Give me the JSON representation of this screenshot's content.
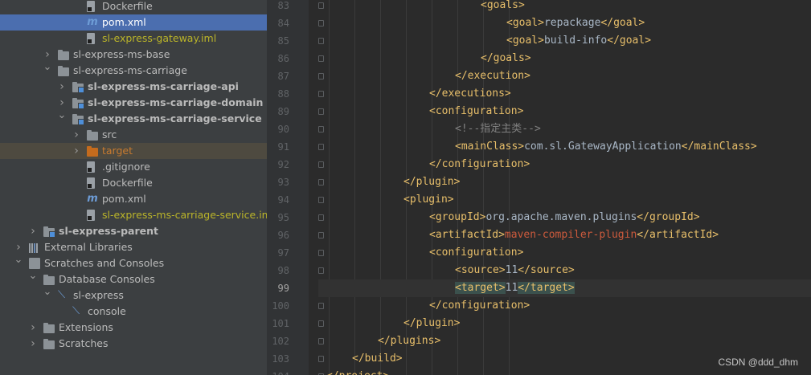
{
  "tree": {
    "rows": [
      {
        "label": "Dockerfile",
        "indent": 4,
        "arrow": "",
        "icon": "file",
        "style": "normal"
      },
      {
        "label": "pom.xml",
        "indent": 4,
        "arrow": "",
        "icon": "maven",
        "style": "selected"
      },
      {
        "label": "sl-express-gateway.iml",
        "indent": 4,
        "arrow": "",
        "icon": "file",
        "style": "yellow"
      },
      {
        "label": "sl-express-ms-base",
        "indent": 2,
        "arrow": "right",
        "icon": "folder",
        "style": "normal"
      },
      {
        "label": "sl-express-ms-carriage",
        "indent": 2,
        "arrow": "down",
        "icon": "folder",
        "style": "normal"
      },
      {
        "label": "sl-express-ms-carriage-api",
        "indent": 3,
        "arrow": "right",
        "icon": "module",
        "style": "bold"
      },
      {
        "label": "sl-express-ms-carriage-domain",
        "indent": 3,
        "arrow": "right",
        "icon": "module",
        "style": "bold"
      },
      {
        "label": "sl-express-ms-carriage-service",
        "indent": 3,
        "arrow": "down",
        "icon": "module",
        "style": "bold"
      },
      {
        "label": "src",
        "indent": 4,
        "arrow": "right",
        "icon": "folder",
        "style": "normal"
      },
      {
        "label": "target",
        "indent": 4,
        "arrow": "right",
        "icon": "folder-orange",
        "style": "excluded"
      },
      {
        "label": ".gitignore",
        "indent": 4,
        "arrow": "",
        "icon": "file",
        "style": "normal"
      },
      {
        "label": "Dockerfile",
        "indent": 4,
        "arrow": "",
        "icon": "file",
        "style": "normal"
      },
      {
        "label": "pom.xml",
        "indent": 4,
        "arrow": "",
        "icon": "maven",
        "style": "normal"
      },
      {
        "label": "sl-express-ms-carriage-service.iml",
        "indent": 4,
        "arrow": "",
        "icon": "file",
        "style": "yellow"
      },
      {
        "label": "sl-express-parent",
        "indent": 1,
        "arrow": "right",
        "icon": "module",
        "style": "bold"
      },
      {
        "label": "External Libraries",
        "indent": 0,
        "arrow": "right",
        "icon": "library",
        "style": "normal"
      },
      {
        "label": "Scratches and Consoles",
        "indent": 0,
        "arrow": "down",
        "icon": "scratch",
        "style": "normal"
      },
      {
        "label": "Database Consoles",
        "indent": 1,
        "arrow": "down",
        "icon": "folder",
        "style": "normal"
      },
      {
        "label": "sl-express",
        "indent": 2,
        "arrow": "down",
        "icon": "db",
        "style": "normal"
      },
      {
        "label": "console",
        "indent": 3,
        "arrow": "",
        "icon": "db",
        "style": "normal"
      },
      {
        "label": "Extensions",
        "indent": 1,
        "arrow": "right",
        "icon": "folder",
        "style": "normal"
      },
      {
        "label": "Scratches",
        "indent": 1,
        "arrow": "right",
        "icon": "folder",
        "style": "normal"
      }
    ]
  },
  "editor": {
    "current_line": 99,
    "lines": [
      {
        "num": "83",
        "level": 7,
        "tokens": [
          {
            "k": "t",
            "s": "<goals>"
          }
        ]
      },
      {
        "num": "84",
        "level": 8,
        "tokens": [
          {
            "k": "t",
            "s": "<goal>"
          },
          {
            "k": "v",
            "s": "repackage"
          },
          {
            "k": "t",
            "s": "</goal>"
          }
        ]
      },
      {
        "num": "85",
        "level": 8,
        "tokens": [
          {
            "k": "t",
            "s": "<goal>"
          },
          {
            "k": "v",
            "s": "build-info"
          },
          {
            "k": "t",
            "s": "</goal>"
          }
        ]
      },
      {
        "num": "86",
        "level": 7,
        "tokens": [
          {
            "k": "t",
            "s": "</goals>"
          }
        ]
      },
      {
        "num": "87",
        "level": 6,
        "tokens": [
          {
            "k": "t",
            "s": "</execution>"
          }
        ]
      },
      {
        "num": "88",
        "level": 5,
        "tokens": [
          {
            "k": "t",
            "s": "</executions>"
          }
        ]
      },
      {
        "num": "89",
        "level": 5,
        "tokens": [
          {
            "k": "t",
            "s": "<configuration>"
          }
        ]
      },
      {
        "num": "90",
        "level": 6,
        "tokens": [
          {
            "k": "c",
            "s": "<!--指定主类-->"
          }
        ]
      },
      {
        "num": "91",
        "level": 6,
        "tokens": [
          {
            "k": "t",
            "s": "<mainClass>"
          },
          {
            "k": "v",
            "s": "com.sl.GatewayApplication"
          },
          {
            "k": "t",
            "s": "</mainClass>"
          }
        ]
      },
      {
        "num": "92",
        "level": 5,
        "tokens": [
          {
            "k": "t",
            "s": "</configuration>"
          }
        ]
      },
      {
        "num": "93",
        "level": 4,
        "tokens": [
          {
            "k": "t",
            "s": "</plugin>"
          }
        ]
      },
      {
        "num": "94",
        "level": 4,
        "tokens": [
          {
            "k": "t",
            "s": "<plugin>"
          }
        ]
      },
      {
        "num": "95",
        "level": 5,
        "tokens": [
          {
            "k": "t",
            "s": "<groupId>"
          },
          {
            "k": "v",
            "s": "org.apache.maven.plugins"
          },
          {
            "k": "t",
            "s": "</groupId>"
          }
        ]
      },
      {
        "num": "96",
        "level": 5,
        "tokens": [
          {
            "k": "t",
            "s": "<artifactId>"
          },
          {
            "k": "r",
            "s": "maven-compiler-plugin"
          },
          {
            "k": "t",
            "s": "</artifactId>"
          }
        ]
      },
      {
        "num": "97",
        "level": 5,
        "tokens": [
          {
            "k": "t",
            "s": "<configuration>"
          }
        ]
      },
      {
        "num": "98",
        "level": 6,
        "tokens": [
          {
            "k": "t",
            "s": "<source>"
          },
          {
            "k": "v",
            "s": "11"
          },
          {
            "k": "t",
            "s": "</source>"
          }
        ]
      },
      {
        "num": "99",
        "level": 6,
        "tokens": [
          {
            "k": "th",
            "s": "<target>"
          },
          {
            "k": "v",
            "s": "11"
          },
          {
            "k": "th",
            "s": "</target>"
          }
        ]
      },
      {
        "num": "100",
        "level": 5,
        "tokens": [
          {
            "k": "t",
            "s": "</configuration>"
          }
        ]
      },
      {
        "num": "101",
        "level": 4,
        "tokens": [
          {
            "k": "t",
            "s": "</plugin>"
          }
        ]
      },
      {
        "num": "102",
        "level": 3,
        "tokens": [
          {
            "k": "t",
            "s": "</plugins>"
          }
        ]
      },
      {
        "num": "103",
        "level": 2,
        "tokens": [
          {
            "k": "t",
            "s": "</build>"
          }
        ]
      },
      {
        "num": "104",
        "level": 1,
        "tokens": [
          {
            "k": "t",
            "s": "</project>"
          }
        ]
      }
    ]
  },
  "watermark": "CSDN @ddd_dhm"
}
